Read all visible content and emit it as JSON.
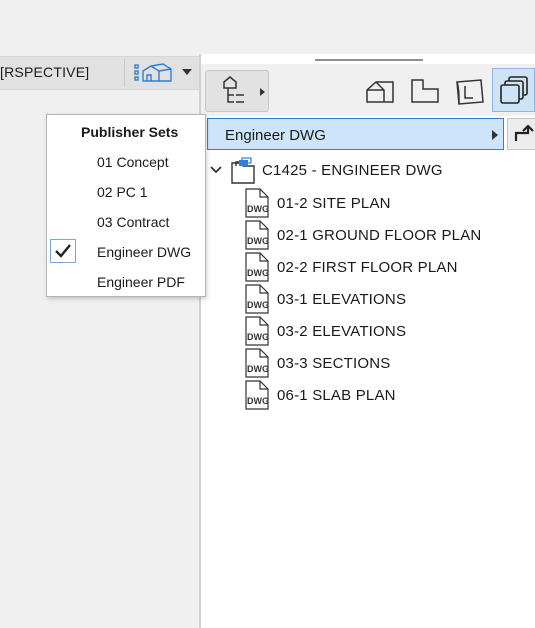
{
  "left": {
    "view_label": "[RSPECTIVE]",
    "view_icon": "view-map-icon",
    "view_caret": "dropdown-caret-icon"
  },
  "toolbar": {
    "buttons": [
      {
        "name": "structure-button",
        "icon": "hierarchy-icon"
      },
      {
        "name": "project-map-button",
        "icon": "house-icon"
      },
      {
        "name": "view-map-button",
        "icon": "floor-plan-icon"
      },
      {
        "name": "layout-book-button",
        "icon": "layout-sheet-icon"
      },
      {
        "name": "publisher-sets-button",
        "icon": "publisher-sets-icon",
        "selected": true
      }
    ]
  },
  "set_bar": {
    "label": "Engineer DWG",
    "up_icon": "go-up-icon"
  },
  "tree": {
    "root": {
      "label": "C1425 - ENGINEER DWG",
      "icon": "publisher-folder-icon",
      "expanded": true
    },
    "items": [
      {
        "label": "01-2 SITE PLAN",
        "icon": "dwg-file-icon"
      },
      {
        "label": "02-1 GROUND FLOOR PLAN",
        "icon": "dwg-file-icon"
      },
      {
        "label": "02-2 FIRST FLOOR PLAN",
        "icon": "dwg-file-icon"
      },
      {
        "label": "03-1 ELEVATIONS",
        "icon": "dwg-file-icon"
      },
      {
        "label": "03-2 ELEVATIONS",
        "icon": "dwg-file-icon"
      },
      {
        "label": "03-3 SECTIONS",
        "icon": "dwg-file-icon"
      },
      {
        "label": "06-1 SLAB PLAN",
        "icon": "dwg-file-icon"
      }
    ]
  },
  "popup": {
    "title": "Publisher Sets",
    "items": [
      {
        "label": "01 Concept",
        "checked": false
      },
      {
        "label": "02 PC 1",
        "checked": false
      },
      {
        "label": "03 Contract",
        "checked": false
      },
      {
        "label": "Engineer DWG",
        "checked": true
      },
      {
        "label": "Engineer PDF",
        "checked": false
      }
    ]
  },
  "colors": {
    "accent": "#3a7fc8",
    "selection": "#cde4fa",
    "icon_blue": "#2f7fd6"
  }
}
